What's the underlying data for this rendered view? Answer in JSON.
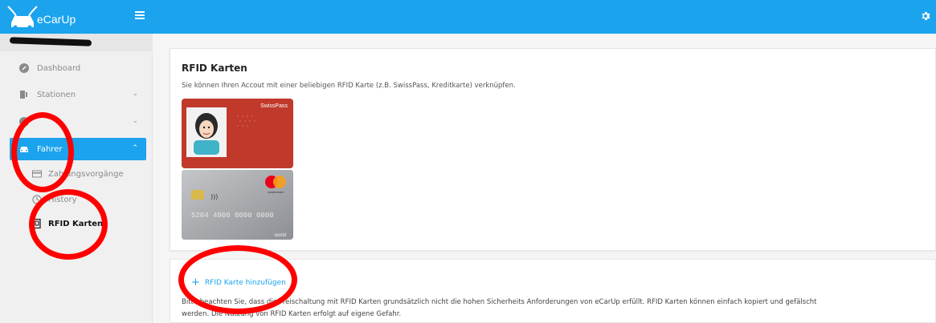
{
  "header": {
    "app_name": "eCarUp",
    "menu_icon": "hamburger-icon",
    "settings_icon": "gear-icon"
  },
  "sidebar": {
    "items": [
      {
        "label": "Dashboard",
        "icon": "dashboard-icon"
      },
      {
        "label": "Stationen",
        "icon": "charging-station-icon"
      },
      {
        "label": "Fahrer",
        "icon": "car-icon"
      }
    ],
    "subitems": [
      {
        "label": "Zahlungsvorgänge",
        "icon": "credit-card-icon"
      },
      {
        "label": "History",
        "icon": "history-icon"
      },
      {
        "label": "RFID Karten",
        "icon": "rfid-card-icon"
      }
    ]
  },
  "main": {
    "title": "RFID Karten",
    "description": "Sie können Ihren Accout mit einer beliebigen RFID Karte (z.B. SwissPass, Kreditkarte) verknüpfen.",
    "swisspass_label": "SwissPass",
    "card_number": "5204 4800 0000 0000",
    "mastercard_label": "mastercard",
    "world_label": "world",
    "add_button": "RFID Karte hinzufügen",
    "warning_line1": "Bitte beachten Sie, dass die Freischaltung mit RFID Karten grundsätzlich nicht die hohen Sicherheits Anforderungen von eCarUp erfüllt. RFID Karten können einfach kopiert und gefälscht",
    "warning_line2": "werden. Die Nutzung von RFID Karten erfolgt auf eigene Gefahr."
  },
  "colors": {
    "primary": "#1ba3ee",
    "annotation": "#ff0000",
    "swisspass_red": "#c0392b",
    "credit_card_grey": "#9ea1a5"
  }
}
